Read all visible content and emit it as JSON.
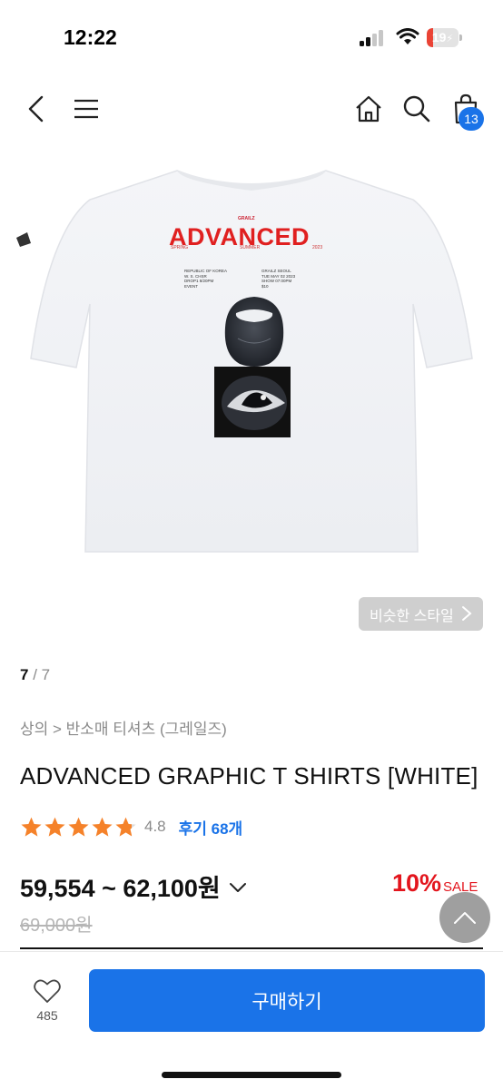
{
  "status_bar": {
    "time": "12:22",
    "battery_level": "19",
    "battery_fraction": 0.19,
    "icons": [
      "signal-icon",
      "wifi-icon",
      "battery-icon"
    ]
  },
  "nav": {
    "icons": [
      "back-arrow-icon",
      "menu-icon",
      "home-icon",
      "search-icon",
      "shopping-bag-icon"
    ],
    "cart_count": "13"
  },
  "product_image": {
    "print_brand": "GRAILZ",
    "print_title": "ADVANCED",
    "print_left": "SPRING",
    "print_center": "SUMMER",
    "print_right": "2023",
    "print_info_left": [
      "REPUBLIC OF KOREA",
      "W. S. CHSR",
      "DROP1 8/20PM",
      "EVENT"
    ],
    "print_info_right": [
      "GRAILZ SEOUL",
      "TUE MAY 02 2023",
      "SHOW 07:00PM",
      "$10"
    ]
  },
  "similar_style_label": "비슷한 스타일",
  "pager": {
    "current": "7",
    "total": " / 7"
  },
  "breadcrumb": "상의 > 반소매 티셔츠 (그레일즈)",
  "product": {
    "title": "ADVANCED GRAPHIC T SHIRTS [WHITE]",
    "rating": "4.8",
    "rating_stars": 4.8,
    "review_label": "후기 68개",
    "price_range": "59,554 ~ 62,100원",
    "discount_rate": "10%",
    "discount_label": "SALE",
    "original_price": "69,000원"
  },
  "bottom_bar": {
    "like_count": "485",
    "buy_label": "구매하기"
  },
  "colors": {
    "accent": "#1a73e8",
    "sale": "#e3151d",
    "star": "#f5822a"
  }
}
